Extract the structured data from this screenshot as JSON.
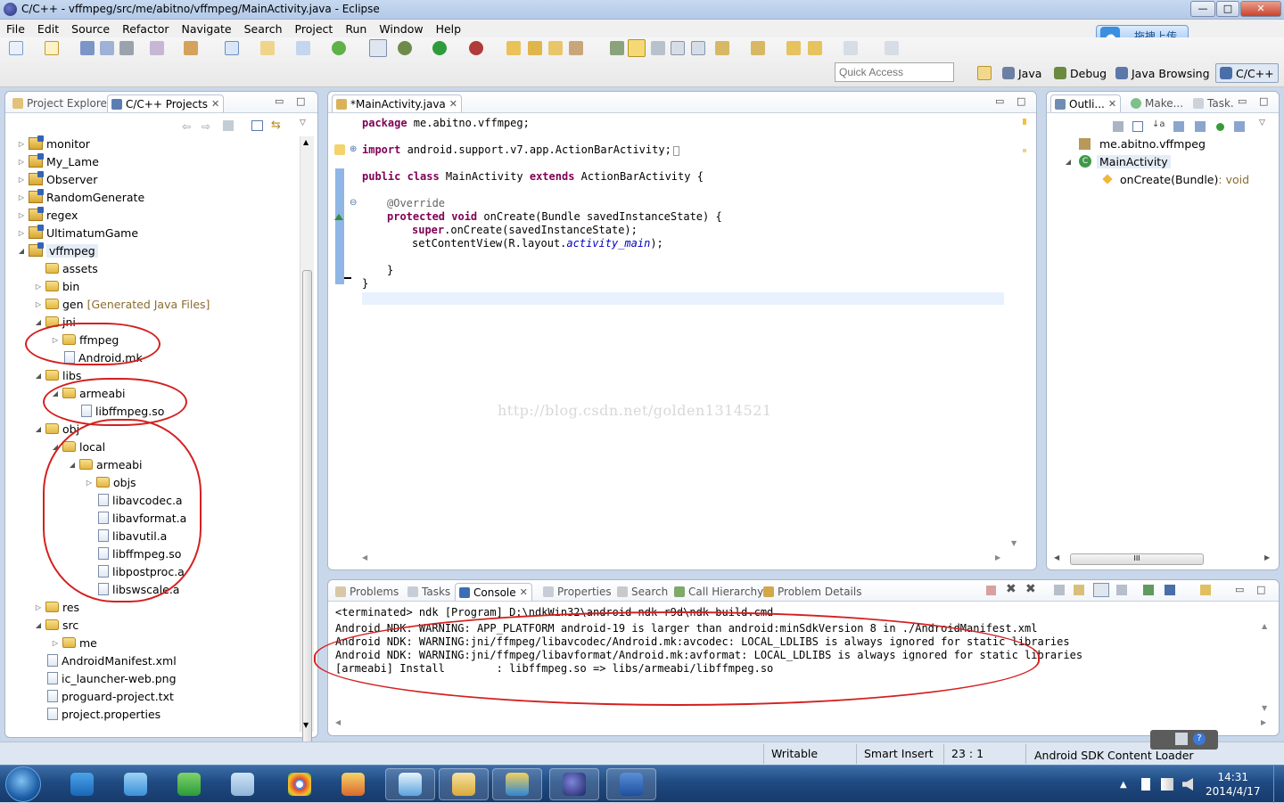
{
  "window": {
    "title": "C/C++ - vffmpeg/src/me/abitno/vffmpeg/MainActivity.java - Eclipse",
    "min": "—",
    "max": "□",
    "close": "✕"
  },
  "menu": [
    "File",
    "Edit",
    "Source",
    "Refactor",
    "Navigate",
    "Search",
    "Project",
    "Run",
    "Window",
    "Help"
  ],
  "upload": {
    "label": "拖拽上传",
    "icon": "cloud-icon"
  },
  "quick_access": {
    "placeholder": "Quick Access"
  },
  "perspectives": [
    {
      "label": "Java",
      "icon": "java-perspective-icon"
    },
    {
      "label": "Debug",
      "icon": "bug-icon"
    },
    {
      "label": "Java Browsing",
      "icon": "java-browsing-icon"
    },
    {
      "label": "C/C++",
      "icon": "cpp-perspective-icon"
    }
  ],
  "explorer": {
    "tabs": [
      {
        "label": "Project Explorer"
      },
      {
        "label": "C/C++ Projects"
      }
    ],
    "rows": [
      {
        "label": "monitor",
        "twisty": "▷"
      },
      {
        "label": "My_Lame",
        "twisty": "▷"
      },
      {
        "label": "Observer",
        "twisty": "▷"
      },
      {
        "label": "RandomGenerate",
        "twisty": "▷"
      },
      {
        "label": "regex",
        "twisty": "▷"
      },
      {
        "label": "UltimatumGame",
        "twisty": "▷"
      },
      {
        "label": "vffmpeg",
        "twisty": "◢"
      },
      {
        "label": "assets",
        "twisty": ""
      },
      {
        "label": "bin",
        "twisty": "▷"
      },
      {
        "label": "gen",
        "extra": "[Generated Java Files]",
        "twisty": "▷"
      },
      {
        "label": "jni",
        "twisty": "◢"
      },
      {
        "label": "ffmpeg",
        "twisty": "▷"
      },
      {
        "label": "Android.mk",
        "twisty": ""
      },
      {
        "label": "libs",
        "twisty": "◢"
      },
      {
        "label": "armeabi",
        "twisty": "◢"
      },
      {
        "label": "libffmpeg.so",
        "twisty": ""
      },
      {
        "label": "obj",
        "twisty": "◢"
      },
      {
        "label": "local",
        "twisty": "◢"
      },
      {
        "label": "armeabi",
        "twisty": "◢"
      },
      {
        "label": "objs",
        "twisty": "▷"
      },
      {
        "label": "libavcodec.a",
        "twisty": ""
      },
      {
        "label": "libavformat.a",
        "twisty": ""
      },
      {
        "label": "libavutil.a",
        "twisty": ""
      },
      {
        "label": "libffmpeg.so",
        "twisty": ""
      },
      {
        "label": "libpostproc.a",
        "twisty": ""
      },
      {
        "label": "libswscale.a",
        "twisty": ""
      },
      {
        "label": "res",
        "twisty": "▷"
      },
      {
        "label": "src",
        "twisty": "◢"
      },
      {
        "label": "me",
        "twisty": "▷"
      },
      {
        "label": "AndroidManifest.xml",
        "twisty": ""
      },
      {
        "label": "ic_launcher-web.png",
        "twisty": ""
      },
      {
        "label": "proguard-project.txt",
        "twisty": ""
      },
      {
        "label": "project.properties",
        "twisty": ""
      }
    ]
  },
  "editor": {
    "tab": "*MainActivity.java",
    "code": {
      "l1_kw": "package",
      "l1_rest": " me.abitno.vffmpeg;",
      "l2_kw": "import",
      "l2_rest": " android.support.v7.app.ActionBarActivity;",
      "l3_kw1": "public class",
      "l3_mid": " MainActivity ",
      "l3_kw2": "extends",
      "l3_rest": " ActionBarActivity {",
      "l4": "@Override",
      "l5_kw": "protected void",
      "l5_rest": " onCreate(Bundle savedInstanceState) {",
      "l6_kw": "super",
      "l6_rest": ".onCreate(savedInstanceState);",
      "l7_a": "setContentView(R.layout.",
      "l7_it": "activity_main",
      "l7_b": ");",
      "l8": "}",
      "l9": "}"
    },
    "watermark": "http://blog.csdn.net/golden1314521"
  },
  "outline": {
    "tabs": [
      {
        "label": "Outli..."
      },
      {
        "label": "Make..."
      },
      {
        "label": "Task."
      }
    ],
    "rows": [
      {
        "label": "me.abitno.vffmpeg"
      },
      {
        "label": "MainActivity"
      },
      {
        "label": "onCreate(Bundle)",
        "type": " : void"
      }
    ],
    "hscroll": "III"
  },
  "console": {
    "tabs": [
      {
        "label": "Problems"
      },
      {
        "label": "Tasks"
      },
      {
        "label": "Console"
      },
      {
        "label": "Properties"
      },
      {
        "label": "Search"
      },
      {
        "label": "Call Hierarchy"
      },
      {
        "label": "Problem Details"
      }
    ],
    "header": "<terminated> ndk [Program] D:\\ndkWin32\\android-ndk-r9d\\ndk-build.cmd",
    "lines": [
      "Android NDK: WARNING: APP_PLATFORM android-19 is larger than android:minSdkVersion 8 in ./AndroidManifest.xml",
      "Android NDK: WARNING:jni/ffmpeg/libavcodec/Android.mk:avcodec: LOCAL_LDLIBS is always ignored for static libraries",
      "Android NDK: WARNING:jni/ffmpeg/libavformat/Android.mk:avformat: LOCAL_LDLIBS is always ignored for static libraries",
      "[armeabi] Install        : libffmpeg.so => libs/armeabi/libffmpeg.so"
    ]
  },
  "status": {
    "writable": "Writable",
    "insert": "Smart Insert",
    "pos": "23 : 1",
    "loader": "Android SDK Content Loader"
  },
  "taskbar": {
    "time": "14:31",
    "date": "2014/4/17",
    "apps": [
      "ie-icon",
      "feather-icon",
      "360-icon",
      "notepad-icon",
      "chrome-icon",
      "tool-icon",
      "cloud-icon",
      "folder-icon",
      "explorer-icon",
      "eclipse-icon",
      "word-icon"
    ]
  }
}
